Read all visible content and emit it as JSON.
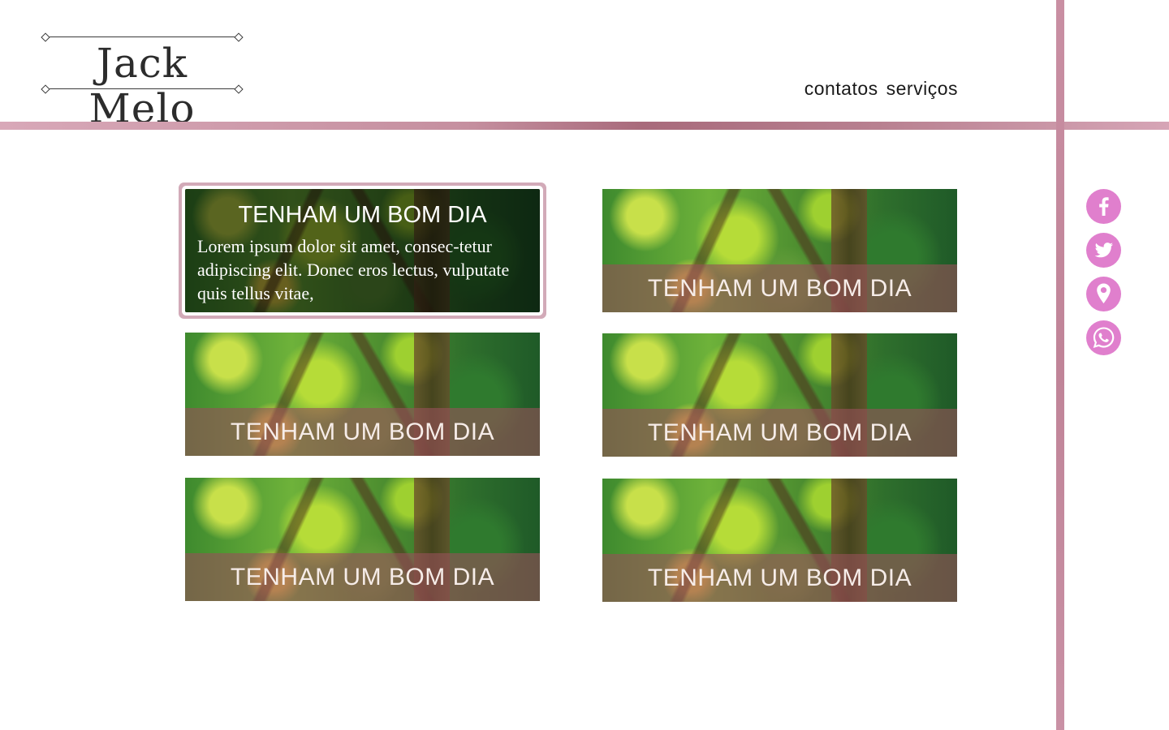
{
  "logo": {
    "text": "Jack Melo"
  },
  "nav": {
    "items": [
      "contatos",
      "serviços"
    ]
  },
  "social": [
    "facebook-icon",
    "twitter-icon",
    "location-pin-icon",
    "whatsapp-icon"
  ],
  "colors": {
    "accent_pink": "#e07fcd",
    "bar_mauve": "#c58f9f",
    "band_overlay": "#965058"
  },
  "cards": [
    {
      "title": "TENHAM UM BOM DIA",
      "body": "Lorem ipsum dolor sit amet, consec-tetur adipiscing elit. Donec eros lectus, vulputate quis tellus vitae,"
    },
    {
      "title": "TENHAM UM BOM DIA"
    },
    {
      "title": "TENHAM UM BOM DIA"
    },
    {
      "title": "TENHAM UM BOM DIA"
    },
    {
      "title": "TENHAM UM BOM DIA"
    },
    {
      "title": "TENHAM UM BOM DIA"
    }
  ]
}
